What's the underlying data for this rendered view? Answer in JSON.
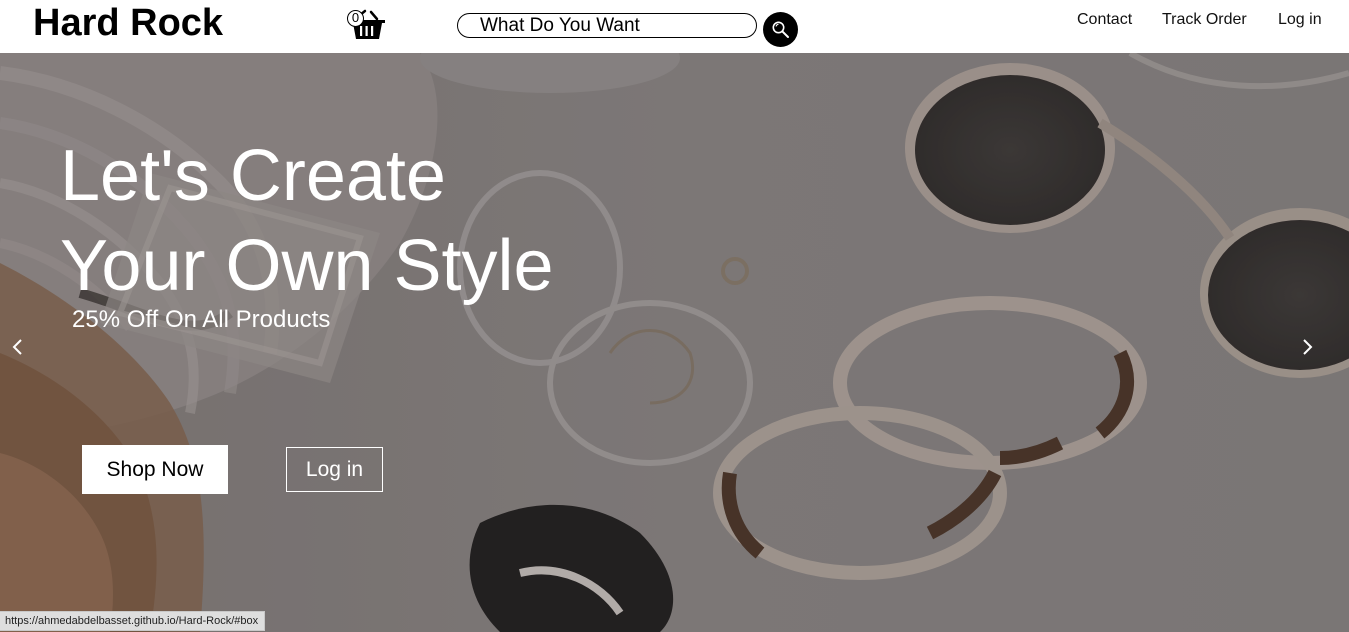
{
  "header": {
    "logo": "Hard Rock",
    "cart_count": "0",
    "search": {
      "placeholder": "What Do You Want",
      "value": ""
    },
    "nav": [
      "Contact",
      "Track Order",
      "Log in"
    ]
  },
  "hero": {
    "title_lines": [
      "Let's Create",
      "Your Own Style"
    ],
    "subtitle": "25% Off On All Products",
    "shop_button": "Shop Now",
    "login_button": "Log in"
  },
  "status_bar": {
    "url": "https://ahmedabdelbasset.github.io/Hard-Rock/#box"
  },
  "icons": {
    "cart": "basket-icon",
    "search": "magnifier-icon",
    "prev": "chevron-left-icon",
    "next": "chevron-right-icon"
  },
  "colors": {
    "header_bg": "#ffffff",
    "hero_overlay": "#7b7776",
    "text_light": "#ffffff",
    "search_button": "#000000"
  }
}
